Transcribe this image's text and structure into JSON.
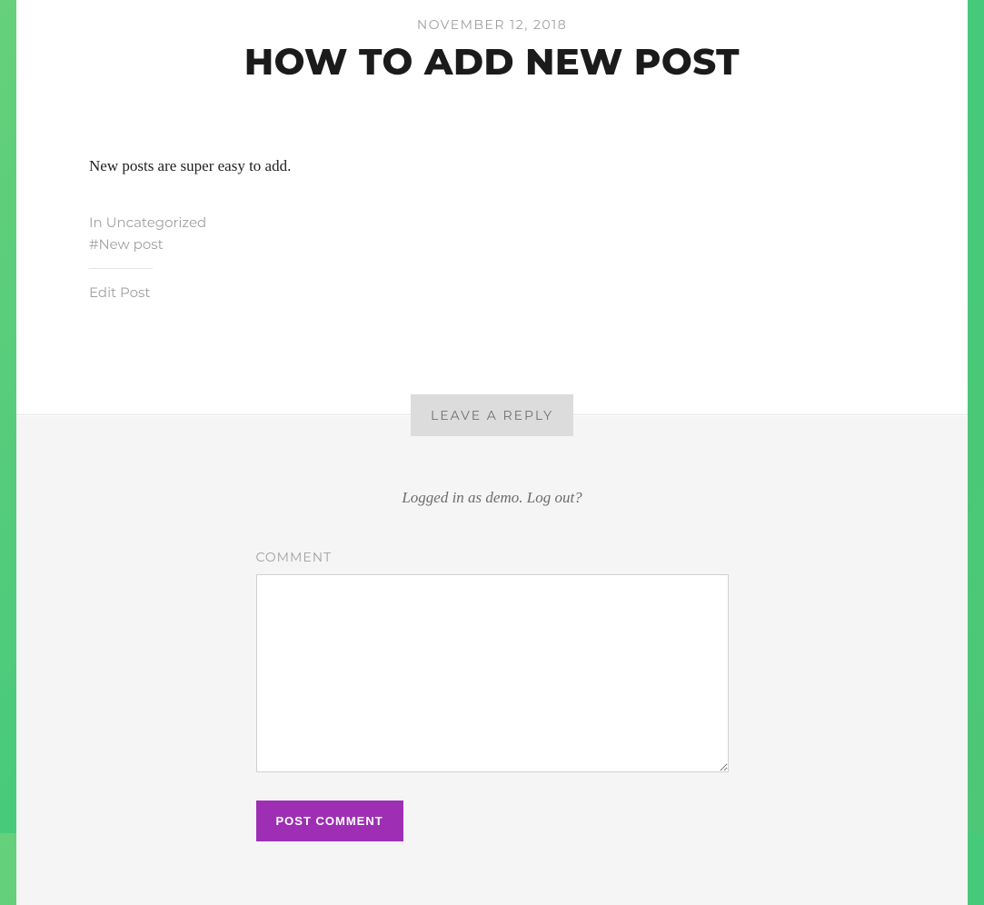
{
  "post": {
    "date": "NOVEMBER 12, 2018",
    "title": "HOW TO ADD NEW POST",
    "body": "New posts are super easy to add."
  },
  "meta": {
    "in_prefix": "In ",
    "category": "Uncategorized",
    "hash": "#",
    "tag": "New post",
    "edit": "Edit Post"
  },
  "reply": {
    "heading": "LEAVE A REPLY",
    "logged_in_prefix": "Logged in as ",
    "username": "demo",
    "period": ". ",
    "logout": "Log out?",
    "comment_label": "COMMENT",
    "submit": "POST COMMENT"
  }
}
